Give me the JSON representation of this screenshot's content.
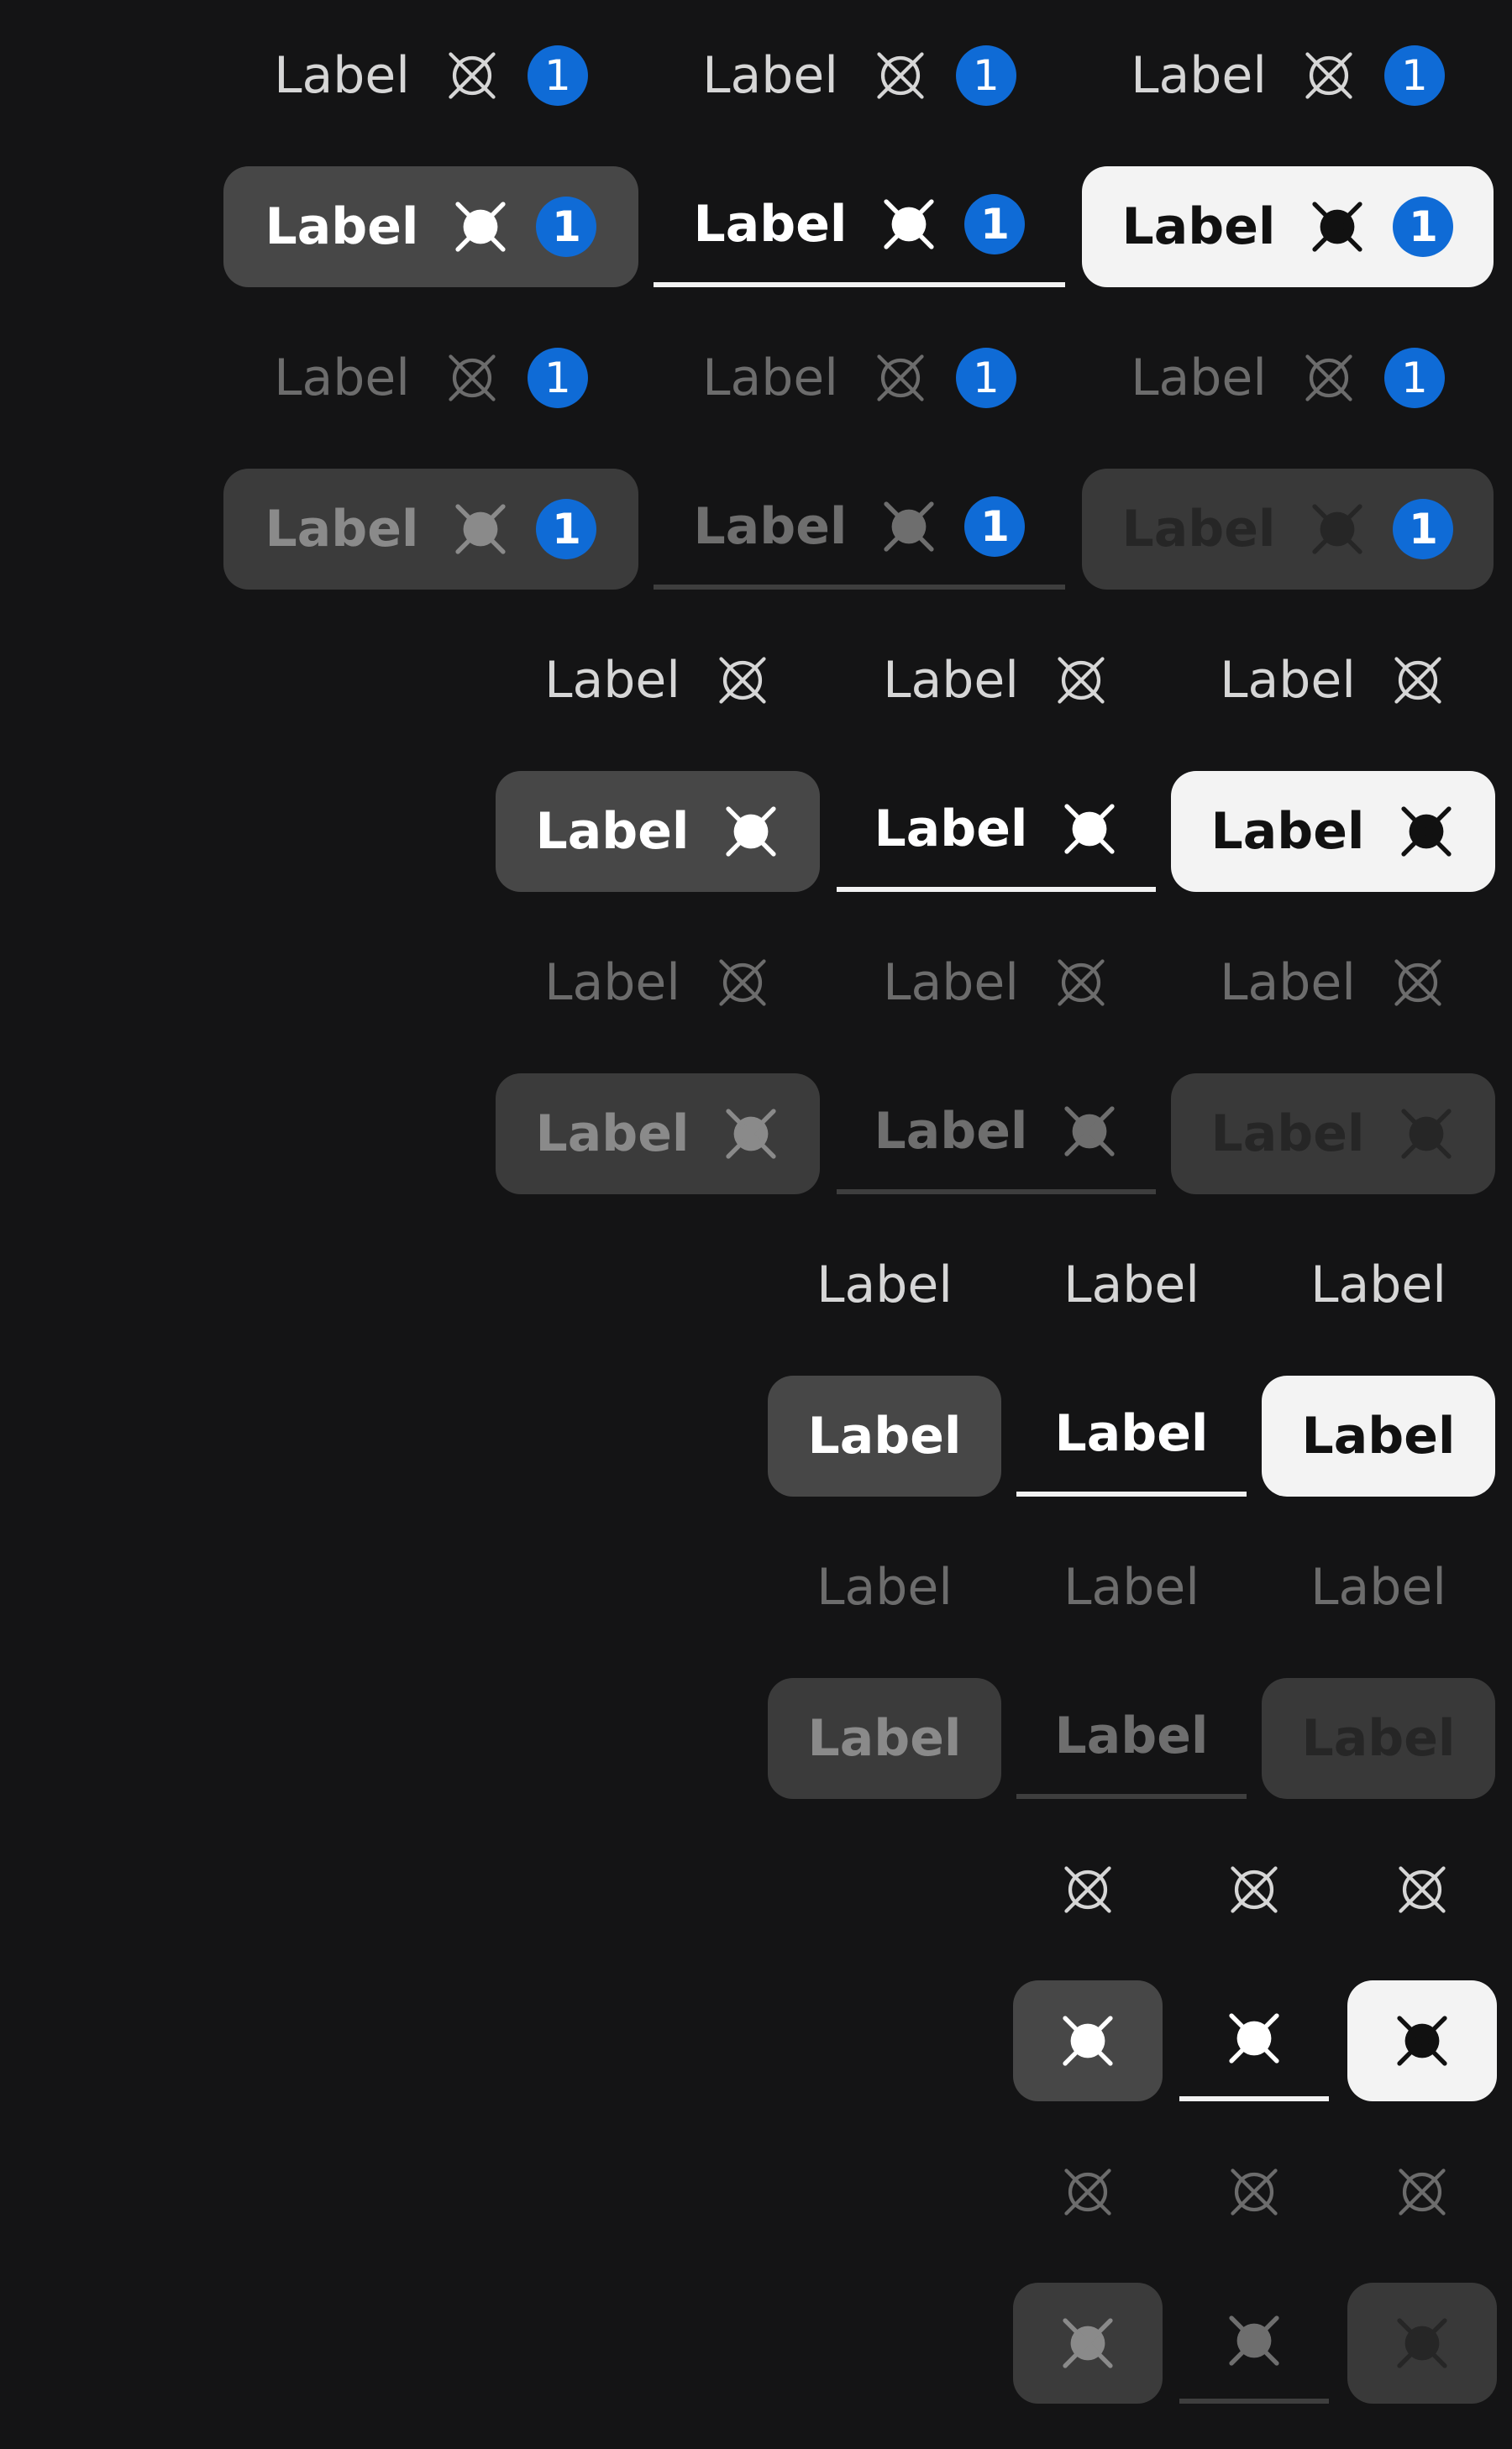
{
  "label": "Label",
  "badge_count": "1",
  "icon": "cross-circle-icon",
  "colors": {
    "background": "#141415",
    "badge": "#0f6bd6",
    "text_enabled": "#d6d6d6",
    "text_disabled": "#6c6c6c",
    "selected_filled": "#474747",
    "selected_solid": "#f3f3f3"
  },
  "sections": [
    {
      "content": "label-icon-badge"
    },
    {
      "content": "label-icon"
    },
    {
      "content": "label"
    },
    {
      "content": "icon"
    }
  ],
  "variants": [
    "filled",
    "underline",
    "solid"
  ],
  "rows": [
    {
      "style": "plain",
      "state": "enabled"
    },
    {
      "style": "selected",
      "state": "enabled"
    },
    {
      "style": "plain",
      "state": "disabled"
    },
    {
      "style": "selected",
      "state": "disabled"
    }
  ]
}
